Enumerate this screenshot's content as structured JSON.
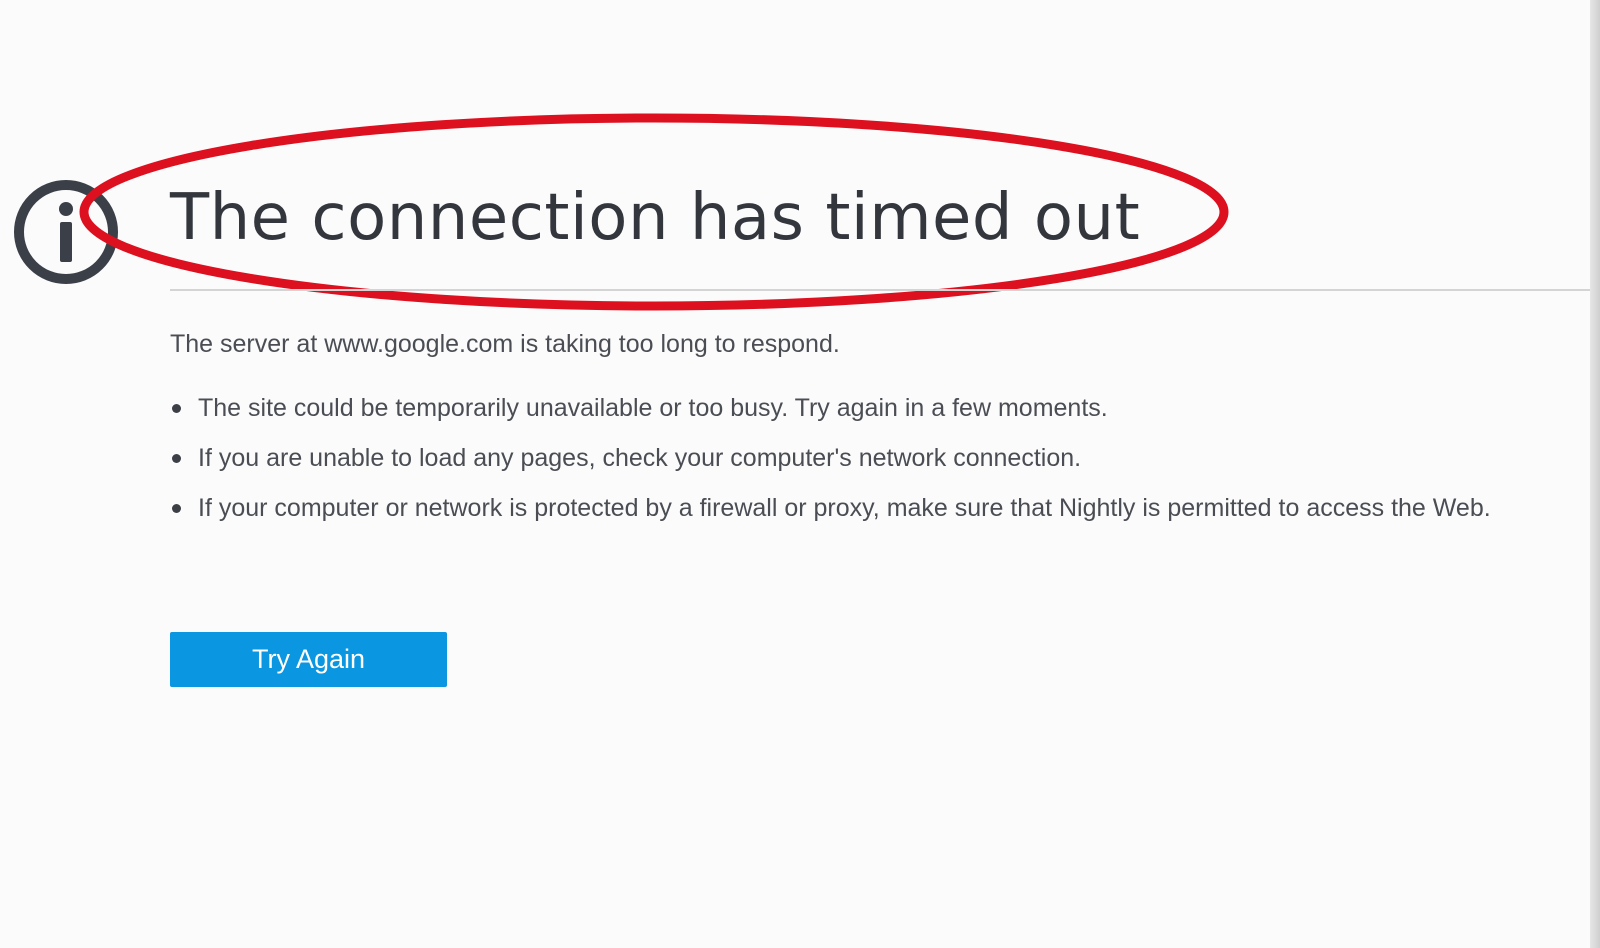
{
  "error_page": {
    "icon": "info-icon",
    "title": "The connection has timed out",
    "server_message": "The server at www.google.com is taking too long to respond.",
    "reasons": [
      "The site could be temporarily unavailable or too busy. Try again in a few moments.",
      "If you are unable to load any pages, check your computer's network connection.",
      "If your computer or network is protected by a firewall or proxy, make sure that Nightly is permitted to access the Web."
    ],
    "try_again_label": "Try Again"
  },
  "colors": {
    "background": "#fbfbfb",
    "text": "#3c3f45",
    "button": "#0a96e0",
    "annotation_ellipse": "#dd1020",
    "divider": "#d4d4d4"
  },
  "annotation": {
    "shape": "ellipse",
    "highlights": "title"
  }
}
